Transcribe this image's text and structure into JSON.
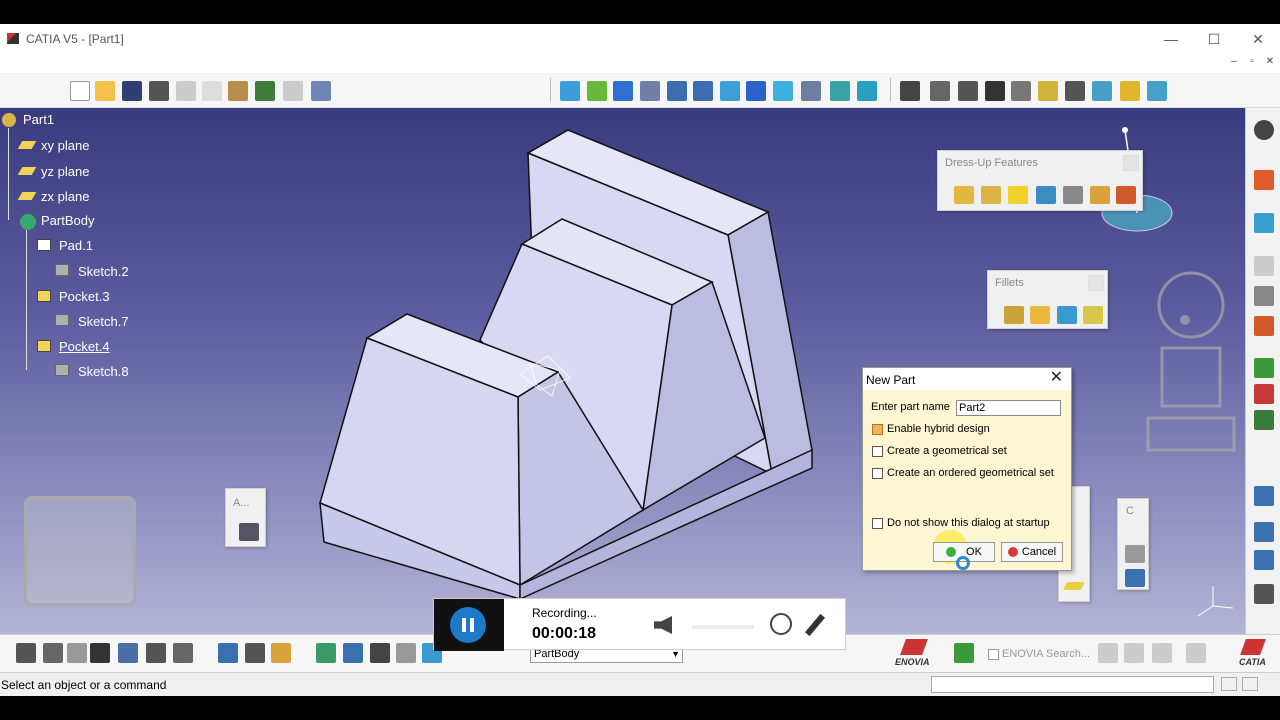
{
  "window": {
    "title": "CATIA V5 - [Part1]",
    "minimize": "—",
    "maximize": "☐",
    "close": "✕"
  },
  "mdi": {
    "minimize": "–",
    "restore": "▫",
    "close": "✕"
  },
  "tree": {
    "root": "Part1",
    "items": [
      {
        "label": "xy plane"
      },
      {
        "label": "yz plane"
      },
      {
        "label": "zx plane"
      },
      {
        "label": "PartBody"
      },
      {
        "label": "Pad.1"
      },
      {
        "label": "Sketch.2"
      },
      {
        "label": "Pocket.3"
      },
      {
        "label": "Sketch.7"
      },
      {
        "label": "Pocket.4"
      },
      {
        "label": "Sketch.8"
      }
    ]
  },
  "panels": {
    "dressup": {
      "title": "Dress-Up Features"
    },
    "fillets": {
      "title": "Fillets"
    },
    "small_a": {
      "title": "A..."
    },
    "small_c": {
      "title": "C"
    }
  },
  "dialog": {
    "title": "New Part",
    "name_label": "Enter part name",
    "name_value": "Part2",
    "options": [
      {
        "label": "Enable hybrid design",
        "checked": true
      },
      {
        "label": "Create a geometrical set",
        "checked": false
      },
      {
        "label": "Create an ordered geometrical set",
        "checked": false
      },
      {
        "label": "Do not show this dialog at startup",
        "checked": false
      }
    ],
    "ok_label": "OK",
    "cancel_label": "Cancel"
  },
  "recorder": {
    "status": "Recording...",
    "time": "00:00:18"
  },
  "bottombar": {
    "body_select": "PartBody",
    "enovia": "ENOVIA",
    "enovia_search": "ENOVIA Search...",
    "catia": "CATIA"
  },
  "statusbar": {
    "message": "Select an object or a command"
  },
  "colors": {
    "viewport_top": "#3a3a7e",
    "viewport_bottom": "#b4b4d6",
    "part_face": "#d8d8f4",
    "dialog_bg": "#fdf6d3",
    "recorder_btn": "#1d7ac9"
  }
}
